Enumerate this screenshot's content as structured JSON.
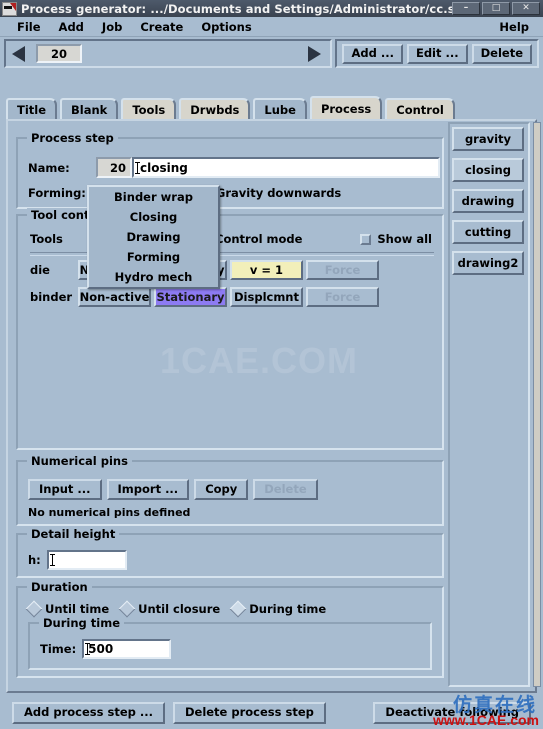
{
  "window": {
    "title": "Process generator: .../Documents and Settings/Administrator/cc.sim",
    "icon": "app-icon",
    "minimize": "–",
    "maximize": "□",
    "close": "✕"
  },
  "menubar": {
    "items": [
      "File",
      "Add",
      "Job",
      "Create",
      "Options"
    ],
    "help": "Help"
  },
  "nav": {
    "prev_icon": "left-triangle-icon",
    "next_icon": "right-triangle-icon",
    "step_number": "20",
    "add_label": "Add ...",
    "edit_label": "Edit ...",
    "delete_label": "Delete"
  },
  "tabs": [
    {
      "label": "Title",
      "style": "blue",
      "selected": false
    },
    {
      "label": "Blank",
      "style": "blue",
      "selected": false
    },
    {
      "label": "Tools",
      "style": "beige",
      "selected": false
    },
    {
      "label": "Drwbds",
      "style": "beige",
      "selected": false
    },
    {
      "label": "Lube",
      "style": "blue",
      "selected": false
    },
    {
      "label": "Process",
      "style": "beige",
      "selected": true
    },
    {
      "label": "Control",
      "style": "beige",
      "selected": false
    }
  ],
  "watermark": {
    "center": "1CAE.COM",
    "bottom_cn": "仿真在线",
    "bottom_url": "www.1CAE.com"
  },
  "process_step": {
    "group_title": "Process step",
    "name_label": "Name:",
    "name_number": "20",
    "name_value": "closing",
    "forming_label": "Forming:",
    "forming_value": "Binder wrap",
    "gravity_text": "Gravity downwards"
  },
  "dropdown": {
    "open": true,
    "items": [
      "Binder wrap",
      "Closing",
      "Drawing",
      "Forming",
      "Hydro mech"
    ]
  },
  "tool_control": {
    "group_title": "Tool control",
    "col_tools": "Tools",
    "col_mode": "Control mode",
    "show_all_label": "Show all",
    "show_all_checked": false,
    "rows": [
      {
        "name": "die",
        "buttons": [
          {
            "label": "Non-active",
            "state": "normal"
          },
          {
            "label": "Stationary",
            "state": "normal"
          },
          {
            "label": "v = 1",
            "state": "yellow"
          },
          {
            "label": "Force",
            "state": "disabled"
          }
        ]
      },
      {
        "name": "binder",
        "buttons": [
          {
            "label": "Non-active",
            "state": "normal"
          },
          {
            "label": "Stationary",
            "state": "selected"
          },
          {
            "label": "Displcmnt",
            "state": "normal"
          },
          {
            "label": "Force",
            "state": "disabled"
          }
        ]
      }
    ]
  },
  "numerical_pins": {
    "group_title": "Numerical pins",
    "buttons": [
      {
        "label": "Input ...",
        "disabled": false
      },
      {
        "label": "Import ...",
        "disabled": false
      },
      {
        "label": "Copy",
        "disabled": false
      },
      {
        "label": "Delete",
        "disabled": true
      }
    ],
    "note": "No numerical pins defined"
  },
  "detail_height": {
    "group_title": "Detail height",
    "label": "h:",
    "value": ""
  },
  "duration": {
    "group_title": "Duration",
    "options": [
      {
        "label": "Until time",
        "selected": false
      },
      {
        "label": "Until closure",
        "selected": false
      },
      {
        "label": "During time",
        "selected": true
      }
    ],
    "during": {
      "group_title": "During time",
      "time_label": "Time:",
      "time_value": "500"
    }
  },
  "sidebar": {
    "items": [
      {
        "label": "gravity",
        "selected": false
      },
      {
        "label": "closing",
        "selected": true
      },
      {
        "label": "drawing",
        "selected": false
      },
      {
        "label": "cutting",
        "selected": false
      },
      {
        "label": "drawing2",
        "selected": false
      }
    ]
  },
  "bottom": {
    "add_step": "Add process step ...",
    "delete_step": "Delete process step",
    "deactivate": "Deactivate following"
  },
  "colors": {
    "background": "#a8bcd0",
    "accent_yellow": "#f2efba",
    "accent_purple": "#8d7bf2",
    "titlebar": "#3f4a59",
    "watermark_red": "#cc1111",
    "watermark_blue": "#2f6fbf"
  }
}
